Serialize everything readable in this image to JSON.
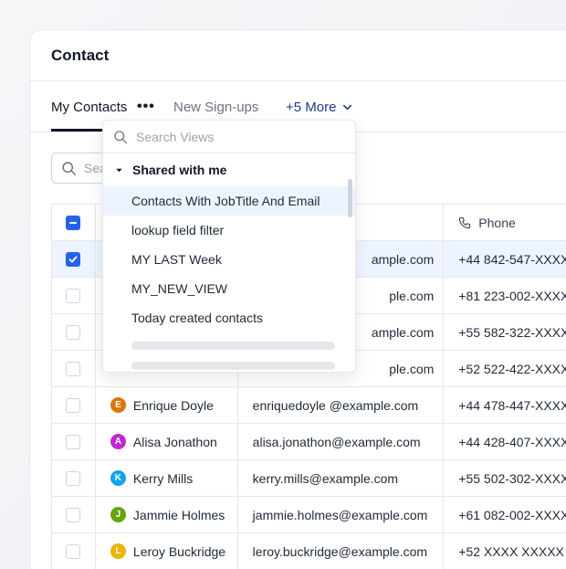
{
  "card": {
    "title": "Contact"
  },
  "tabs": {
    "my_contacts": "My Contacts",
    "more_dots": "•••",
    "new_signups": "New Sign-ups",
    "more": "+5 More"
  },
  "search": {
    "placeholder": "Search"
  },
  "table": {
    "phone_header": "Phone",
    "rows": [
      {
        "name": "",
        "email": "ample.com",
        "phone": "+44 842-547-XXXX",
        "selected": true
      },
      {
        "name": "",
        "email": "ple.com",
        "phone": "+81 223-002-XXXX"
      },
      {
        "name": "",
        "email": "ample.com",
        "phone": "+55 582-322-XXXX"
      },
      {
        "name": "",
        "email": "ple.com",
        "phone": "+52 522-422-XXXX"
      },
      {
        "name": "Enrique Doyle",
        "initial": "E",
        "email": "enriquedoyle @example.com",
        "phone": "+44 478-447-XXXX"
      },
      {
        "name": "Alisa Jonathon",
        "initial": "A",
        "email": "alisa.jonathon@example.com",
        "phone": "+44 428-407-XXXX"
      },
      {
        "name": "Kerry Mills",
        "initial": "K",
        "email": "kerry.mills@example.com",
        "phone": "+55 502-302-XXXX"
      },
      {
        "name": "Jammie Holmes",
        "initial": "J",
        "email": "jammie.holmes@example.com",
        "phone": "+61 082-002-XXXX"
      },
      {
        "name": "Leroy Buckridge",
        "initial": "L",
        "email": "leroy.buckridge@example.com",
        "phone": "+52 XXXX XXXXX"
      }
    ]
  },
  "dropdown": {
    "search_placeholder": "Search Views",
    "group_label": "Shared with me",
    "items": [
      "Contacts With JobTitle And Email",
      "lookup field filter",
      "MY LAST Week",
      "MY_NEW_VIEW",
      "Today created contacts"
    ]
  },
  "colors": {
    "accent": "#2563eb",
    "avatar_e": "#d97706",
    "avatar_a": "#c026d3",
    "avatar_k": "#0ea5e9",
    "avatar_j": "#65a30d",
    "avatar_l": "#eab308"
  }
}
